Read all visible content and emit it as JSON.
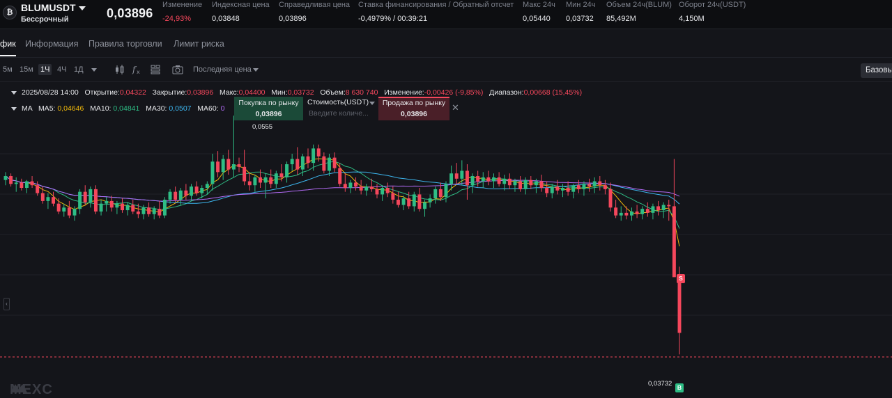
{
  "header": {
    "coin_icon": "bitcoin-icon",
    "symbol": "BLUMUSDT",
    "contract_type": "Бессрочный",
    "last_price": "0,03896",
    "stats": [
      {
        "label": "Изменение",
        "value": "-24,93%",
        "tone": "red"
      },
      {
        "label": "Индексная цена",
        "value": "0,03848",
        "tone": "normal"
      },
      {
        "label": "Справедливая цена",
        "value": "0,03896",
        "tone": "normal"
      },
      {
        "label": "Ставка финансирования / Обратный отсчет",
        "value": "-0,4979% / 00:39:21",
        "tone": "normal"
      },
      {
        "label": "Макс 24ч",
        "value": "0,05440",
        "tone": "normal"
      },
      {
        "label": "Мин 24ч",
        "value": "0,03732",
        "tone": "normal"
      },
      {
        "label": "Объем 24ч(BLUM)",
        "value": "85,492M",
        "tone": "normal"
      },
      {
        "label": "Оборот 24ч(USDT)",
        "value": "4,150M",
        "tone": "normal"
      }
    ]
  },
  "tabs": [
    {
      "label": "фик",
      "active": true
    },
    {
      "label": "Информация",
      "active": false
    },
    {
      "label": "Правила торговли",
      "active": false
    },
    {
      "label": "Лимит риска",
      "active": false
    }
  ],
  "toolbar": {
    "timeframes": [
      {
        "label": "5м",
        "active": false
      },
      {
        "label": "15м",
        "active": false
      },
      {
        "label": "1Ч",
        "active": true
      },
      {
        "label": "4Ч",
        "active": false
      },
      {
        "label": "1Д",
        "active": false
      }
    ],
    "price_type": "Последняя цена",
    "view_button": "Базовый"
  },
  "legend": {
    "ohlc": {
      "date": "2025/08/28 14:00",
      "open_label": "Открытие:",
      "open": "0,04322",
      "close_label": "Закрытие:",
      "close": "0,03896",
      "high_label": "Макс:",
      "high": "0,04400",
      "low_label": "Мин:",
      "low": "0,03732",
      "volume_label": "Объем:",
      "volume": "8 630 740",
      "change_label": "Изменение:",
      "change": "-0,00426 (-9,85%)",
      "range_label": "Диапазон:",
      "range": "0,00668 (15,45%)"
    },
    "ma": {
      "title": "MA",
      "ma5_label": "MA5:",
      "ma5": "0,04646",
      "ma10_label": "MA10:",
      "ma10": "0,04841",
      "ma30_label": "MA30:",
      "ma30": "0,0507",
      "ma60_label": "MA60:",
      "ma60": "0"
    }
  },
  "quick_trade": {
    "buy_label": "Покупка по рынку",
    "buy_price": "0,03896",
    "amount_unit": "Стоимость(USDT)",
    "amount_placeholder": "Введите количе...",
    "sell_label": "Продажа по рынку",
    "sell_price": "0,03896"
  },
  "chart_labels": {
    "high_marker": "0,0555",
    "low_marker": "0,03732",
    "sell_marker": "S",
    "buy_marker": "B"
  },
  "watermark": "MEXC",
  "colors": {
    "up": "#2ebd85",
    "down": "#f5475c",
    "ma5": "#f0b90b",
    "ma10": "#2ebd85",
    "ma30": "#3db7f0",
    "ma60": "#b26bf5"
  },
  "chart_data": {
    "type": "candlestick",
    "timeframe": "1Ч",
    "last_price": 0.03896,
    "y_range": [
      0.034,
      0.058
    ],
    "ohlc": [
      [
        0.0506,
        0.0512,
        0.0502,
        0.0509
      ],
      [
        0.0509,
        0.0511,
        0.0501,
        0.0503
      ],
      [
        0.0503,
        0.0508,
        0.0497,
        0.0504
      ],
      [
        0.0504,
        0.0507,
        0.0498,
        0.05
      ],
      [
        0.05,
        0.0506,
        0.0496,
        0.0505
      ],
      [
        0.0505,
        0.0509,
        0.05,
        0.0502
      ],
      [
        0.0502,
        0.0505,
        0.0494,
        0.0496
      ],
      [
        0.0496,
        0.0501,
        0.0488,
        0.049
      ],
      [
        0.049,
        0.0496,
        0.0484,
        0.0493
      ],
      [
        0.0493,
        0.0497,
        0.0486,
        0.0488
      ],
      [
        0.0488,
        0.0492,
        0.048,
        0.0482
      ],
      [
        0.0482,
        0.0488,
        0.0478,
        0.0485
      ],
      [
        0.0485,
        0.049,
        0.0477,
        0.0479
      ],
      [
        0.0479,
        0.0486,
        0.0475,
        0.0484
      ],
      [
        0.0484,
        0.0499,
        0.048,
        0.0497
      ],
      [
        0.0497,
        0.0502,
        0.0487,
        0.0489
      ],
      [
        0.0489,
        0.0501,
        0.0485,
        0.0499
      ],
      [
        0.0499,
        0.0502,
        0.048,
        0.0482
      ],
      [
        0.0482,
        0.0491,
        0.0479,
        0.0488
      ],
      [
        0.0488,
        0.0493,
        0.0482,
        0.049
      ],
      [
        0.049,
        0.0494,
        0.0482,
        0.0485
      ],
      [
        0.0485,
        0.049,
        0.048,
        0.0488
      ],
      [
        0.0488,
        0.0492,
        0.0481,
        0.0483
      ],
      [
        0.0483,
        0.0489,
        0.0479,
        0.0487
      ],
      [
        0.0487,
        0.0491,
        0.048,
        0.0482
      ],
      [
        0.0482,
        0.0488,
        0.0477,
        0.048
      ],
      [
        0.048,
        0.0487,
        0.0476,
        0.0485
      ],
      [
        0.0485,
        0.0489,
        0.0478,
        0.048
      ],
      [
        0.048,
        0.0486,
        0.0476,
        0.0484
      ],
      [
        0.0484,
        0.049,
        0.0477,
        0.0479
      ],
      [
        0.0479,
        0.0493,
        0.0477,
        0.0491
      ],
      [
        0.0491,
        0.0499,
        0.0488,
        0.0497
      ],
      [
        0.0497,
        0.0501,
        0.0489,
        0.0491
      ],
      [
        0.0491,
        0.05,
        0.0487,
        0.0498
      ],
      [
        0.0498,
        0.0503,
        0.0491,
        0.0494
      ],
      [
        0.0494,
        0.0503,
        0.049,
        0.0501
      ],
      [
        0.0501,
        0.0505,
        0.0494,
        0.0496
      ],
      [
        0.0496,
        0.0502,
        0.0492,
        0.05
      ],
      [
        0.05,
        0.0505,
        0.0495,
        0.0503
      ],
      [
        0.0503,
        0.0526,
        0.0498,
        0.052
      ],
      [
        0.052,
        0.0528,
        0.0508,
        0.0512
      ],
      [
        0.0512,
        0.0525,
        0.0506,
        0.0522
      ],
      [
        0.0522,
        0.0529,
        0.051,
        0.0514
      ],
      [
        0.0514,
        0.0555,
        0.0508,
        0.0518
      ],
      [
        0.0518,
        0.0523,
        0.0512,
        0.0516
      ],
      [
        0.0516,
        0.0529,
        0.0502,
        0.0505
      ],
      [
        0.0505,
        0.0512,
        0.0498,
        0.0502
      ],
      [
        0.0502,
        0.051,
        0.0497,
        0.0508
      ],
      [
        0.0508,
        0.0514,
        0.05,
        0.0504
      ],
      [
        0.0504,
        0.0511,
        0.0492,
        0.0508
      ],
      [
        0.0508,
        0.0514,
        0.05,
        0.0503
      ],
      [
        0.0503,
        0.0513,
        0.05,
        0.0511
      ],
      [
        0.0511,
        0.0518,
        0.0505,
        0.0508
      ],
      [
        0.0508,
        0.052,
        0.0504,
        0.0518
      ],
      [
        0.0518,
        0.0526,
        0.0513,
        0.0522
      ],
      [
        0.0522,
        0.0531,
        0.051,
        0.0514
      ],
      [
        0.0514,
        0.0526,
        0.0509,
        0.0524
      ],
      [
        0.0524,
        0.053,
        0.0515,
        0.0519
      ],
      [
        0.0519,
        0.0533,
        0.0513,
        0.053
      ],
      [
        0.053,
        0.0533,
        0.052,
        0.0524
      ],
      [
        0.0524,
        0.0527,
        0.0511,
        0.0513
      ],
      [
        0.0513,
        0.0526,
        0.0509,
        0.0523
      ],
      [
        0.0523,
        0.0527,
        0.0512,
        0.0515
      ],
      [
        0.0515,
        0.0519,
        0.0501,
        0.0503
      ],
      [
        0.0503,
        0.0511,
        0.0497,
        0.05
      ],
      [
        0.05,
        0.0506,
        0.0496,
        0.0504
      ],
      [
        0.0504,
        0.0508,
        0.0498,
        0.0501
      ],
      [
        0.0501,
        0.0506,
        0.0495,
        0.0498
      ],
      [
        0.0498,
        0.0503,
        0.0494,
        0.0501
      ],
      [
        0.0501,
        0.0507,
        0.0497,
        0.0499
      ],
      [
        0.0499,
        0.0503,
        0.0492,
        0.0495
      ],
      [
        0.0495,
        0.0502,
        0.049,
        0.05
      ],
      [
        0.05,
        0.0504,
        0.0493,
        0.0496
      ],
      [
        0.0496,
        0.0501,
        0.0488,
        0.0491
      ],
      [
        0.0491,
        0.0497,
        0.0485,
        0.0487
      ],
      [
        0.0487,
        0.0494,
        0.0483,
        0.0492
      ],
      [
        0.0492,
        0.0497,
        0.0484,
        0.0486
      ],
      [
        0.0486,
        0.0497,
        0.0482,
        0.0495
      ],
      [
        0.0495,
        0.05,
        0.0482,
        0.0484
      ],
      [
        0.0484,
        0.0491,
        0.0478,
        0.0489
      ],
      [
        0.0489,
        0.0495,
        0.0485,
        0.0492
      ],
      [
        0.0492,
        0.0501,
        0.0488,
        0.0499
      ],
      [
        0.0499,
        0.0504,
        0.049,
        0.0493
      ],
      [
        0.0493,
        0.0505,
        0.0489,
        0.0503
      ],
      [
        0.0503,
        0.0517,
        0.0498,
        0.0511
      ],
      [
        0.0511,
        0.0519,
        0.0503,
        0.0507
      ],
      [
        0.0507,
        0.0521,
        0.0502,
        0.0513
      ],
      [
        0.0513,
        0.0518,
        0.0491,
        0.0502
      ],
      [
        0.0502,
        0.0511,
        0.0496,
        0.0509
      ],
      [
        0.0509,
        0.0513,
        0.0501,
        0.0505
      ],
      [
        0.0505,
        0.0512,
        0.05,
        0.0508
      ],
      [
        0.0508,
        0.0513,
        0.0502,
        0.0505
      ],
      [
        0.0505,
        0.0511,
        0.05,
        0.0508
      ],
      [
        0.0508,
        0.0512,
        0.0501,
        0.0503
      ],
      [
        0.0503,
        0.051,
        0.0498,
        0.0507
      ],
      [
        0.0507,
        0.0511,
        0.0499,
        0.0502
      ],
      [
        0.0502,
        0.0507,
        0.0497,
        0.0505
      ],
      [
        0.0505,
        0.0509,
        0.0497,
        0.0499
      ],
      [
        0.0499,
        0.0508,
        0.0495,
        0.0506
      ],
      [
        0.0506,
        0.0509,
        0.0499,
        0.0502
      ],
      [
        0.0502,
        0.0507,
        0.0496,
        0.0505
      ],
      [
        0.0505,
        0.051,
        0.0497,
        0.05
      ],
      [
        0.05,
        0.0505,
        0.0493,
        0.0496
      ],
      [
        0.0496,
        0.0503,
        0.0492,
        0.0501
      ],
      [
        0.0501,
        0.0506,
        0.0495,
        0.0498
      ],
      [
        0.0498,
        0.0503,
        0.0493,
        0.05
      ],
      [
        0.05,
        0.0505,
        0.0494,
        0.0497
      ],
      [
        0.0497,
        0.0503,
        0.0492,
        0.0502
      ],
      [
        0.0502,
        0.0506,
        0.0496,
        0.0499
      ],
      [
        0.0499,
        0.0505,
        0.0494,
        0.0503
      ],
      [
        0.0503,
        0.0507,
        0.0497,
        0.0501
      ],
      [
        0.0501,
        0.0508,
        0.0496,
        0.0505
      ],
      [
        0.0505,
        0.0509,
        0.0498,
        0.0502
      ],
      [
        0.0502,
        0.0506,
        0.0495,
        0.0499
      ],
      [
        0.0499,
        0.0504,
        0.0482,
        0.0485
      ],
      [
        0.0485,
        0.0491,
        0.0477,
        0.0479
      ],
      [
        0.0479,
        0.0486,
        0.0475,
        0.0481
      ],
      [
        0.0481,
        0.0486,
        0.0476,
        0.0479
      ],
      [
        0.0479,
        0.0485,
        0.0475,
        0.0482
      ],
      [
        0.0482,
        0.0487,
        0.0477,
        0.048
      ],
      [
        0.048,
        0.0486,
        0.0476,
        0.0484
      ],
      [
        0.0484,
        0.0489,
        0.0478,
        0.0481
      ],
      [
        0.0481,
        0.0488,
        0.0476,
        0.0486
      ],
      [
        0.0486,
        0.049,
        0.0479,
        0.0483
      ],
      [
        0.0483,
        0.0489,
        0.0477,
        0.0487
      ],
      [
        0.0487,
        0.0491,
        0.0475,
        0.0486
      ],
      [
        0.0486,
        0.0522,
        0.0438,
        0.0432
      ],
      [
        0.04322,
        0.044,
        0.03732,
        0.03896
      ]
    ],
    "ma_series": [
      {
        "name": "MA5",
        "color": "#f0b90b"
      },
      {
        "name": "MA10",
        "color": "#2ebd85"
      },
      {
        "name": "MA30",
        "color": "#3db7f0"
      },
      {
        "name": "MA60",
        "color": "#b26bf5"
      }
    ],
    "grid": true
  }
}
